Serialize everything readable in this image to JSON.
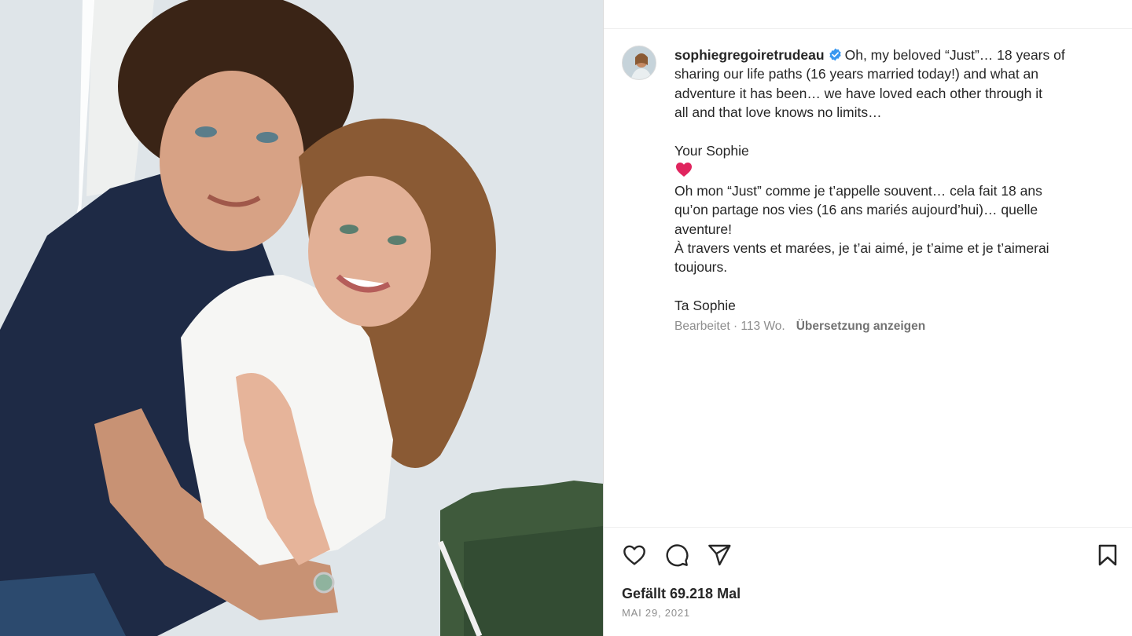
{
  "post": {
    "username": "sophiegregoiretrudeau",
    "caption": {
      "english_lines": [
        "Oh, my beloved “Just”… 18 years of",
        "sharing our life paths (16 years married today!) and what an",
        "adventure it has been… we have loved each other through it",
        "all and that love knows no limits…"
      ],
      "sign_en": "Your Sophie",
      "french_lines": [
        "Oh mon “Just” comme je t’appelle souvent… cela fait 18 ans",
        "qu’on partage nos vies (16 ans mariés aujourd’hui)… quelle",
        "aventure!",
        "À travers vents et marées, je t’ai aimé, je t’aime et je t’aimerai",
        "toujours."
      ],
      "sign_fr": "Ta Sophie"
    },
    "meta": {
      "edited": "Bearbeitet · 113 Wo.",
      "translate": "Übersetzung anzeigen"
    },
    "likes": "Gefällt 69.218 Mal",
    "date": "MAI 29, 2021"
  },
  "icons": {
    "verified": "verified-badge-icon",
    "heart_emoji": "red-heart-emoji",
    "like": "heart-icon",
    "comment": "comment-icon",
    "share": "paper-plane-icon",
    "save": "bookmark-icon"
  },
  "colors": {
    "verified_blue": "#3897f0",
    "text": "#262626",
    "secondary_text": "#8e8e8e",
    "heart_red": "#e0245e"
  }
}
